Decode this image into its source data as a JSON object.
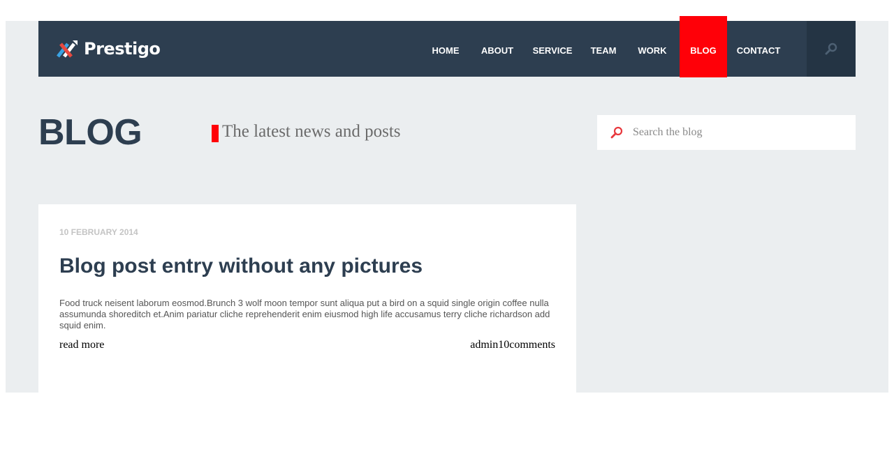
{
  "brand": {
    "name": "Prestigo",
    "logo_icon": "crossed-arrows-logo-icon"
  },
  "nav": {
    "items": [
      {
        "label": "HOME"
      },
      {
        "label": "ABOUT"
      },
      {
        "label": "SERVICE"
      },
      {
        "label": "TEAM"
      },
      {
        "label": "WORK"
      },
      {
        "label": "BLOG",
        "active": true
      },
      {
        "label": "CONTACT"
      }
    ],
    "search_icon": "search-icon"
  },
  "page": {
    "heading": "BLOG",
    "tagline": "The latest news and posts"
  },
  "search": {
    "placeholder": "Search the blog",
    "value": ""
  },
  "post": {
    "date": "10 FEBRUARY 2014",
    "title": "Blog post entry without any pictures",
    "excerpt": "Food truck neisent laborum eosmod.Brunch 3 wolf moon tempor sunt aliqua put a bird on a squid single origin coffee nulla assumunda shoreditch et.Anim pariatur cliche reprehenderit enim eiusmod high life accusamus terry cliche richardson add squid enim.",
    "read_more": "read more",
    "author": "admin",
    "comments": "10comments"
  },
  "colors": {
    "navbar": "#2d3e50",
    "accent": "#ff0008",
    "page_background": "#ebeef0",
    "heading": "#2d3e50"
  }
}
